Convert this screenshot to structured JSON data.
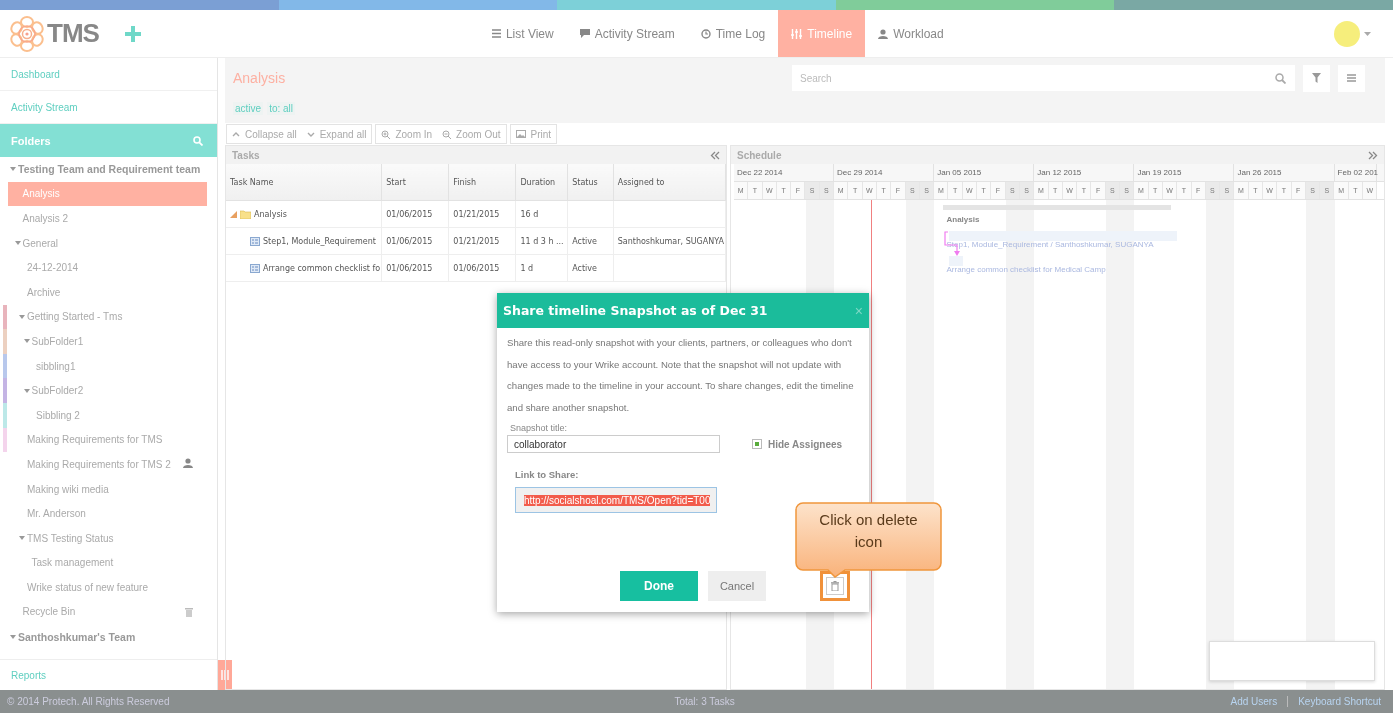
{
  "top_nav": {
    "logo": "TMS",
    "tabs": [
      {
        "label": "List View",
        "selected": false
      },
      {
        "label": "Activity Stream",
        "selected": false
      },
      {
        "label": "Time Log",
        "selected": false
      },
      {
        "label": "Timeline",
        "selected": true
      },
      {
        "label": "Workload",
        "selected": false
      }
    ]
  },
  "sidebar": {
    "links": [
      "Dashboard",
      "Activity Stream"
    ],
    "folders_title": "Folders",
    "tree": [
      {
        "label": "Testing Team and Requirement team",
        "kind": "team",
        "selected": false,
        "expanded": true,
        "children": [
          {
            "label": "Analysis",
            "kind": "folder",
            "selected": true
          },
          {
            "label": "Analysis 2",
            "kind": "folder",
            "selected": false
          },
          {
            "label": "General",
            "kind": "folder",
            "selected": false,
            "expanded": true,
            "children": [
              {
                "label": "24-12-2014",
                "kind": "folder",
                "selected": false
              },
              {
                "label": "Archive",
                "kind": "folder",
                "selected": false
              },
              {
                "label": "Getting Started - Tms",
                "kind": "folder",
                "selected": false,
                "expanded": true,
                "color": "#e8b4bc",
                "children": [
                  {
                    "label": "SubFolder1",
                    "kind": "folder",
                    "selected": false,
                    "expanded": true,
                    "color": "#ecd0c0",
                    "children": [
                      {
                        "label": "sibbling1",
                        "kind": "folder",
                        "selected": false,
                        "color": "#b8c8ec"
                      }
                    ]
                  },
                  {
                    "label": "SubFolder2",
                    "kind": "folder",
                    "selected": false,
                    "expanded": true,
                    "color": "#c4b4e4",
                    "children": [
                      {
                        "label": "Sibbling 2",
                        "kind": "folder",
                        "selected": false,
                        "color": "#bce8e8"
                      }
                    ]
                  }
                ]
              },
              {
                "label": "Making Requirements for TMS",
                "kind": "folder",
                "selected": false,
                "color": "#f4d4ec"
              },
              {
                "label": "Making Requirements for TMS 2",
                "kind": "shared",
                "selected": false
              },
              {
                "label": "Making wiki media",
                "kind": "folder",
                "selected": false
              },
              {
                "label": "Mr. Anderson",
                "kind": "folder",
                "selected": false
              },
              {
                "label": "TMS Testing Status",
                "kind": "folder",
                "selected": false,
                "expanded": true,
                "children": [
                  {
                    "label": "Task management",
                    "kind": "folder",
                    "selected": false
                  }
                ]
              },
              {
                "label": "Wrike status of new feature",
                "kind": "folder",
                "selected": false
              }
            ]
          },
          {
            "label": "Recycle Bin",
            "kind": "bin",
            "selected": false
          }
        ]
      },
      {
        "label": "Santhoshkumar's Team",
        "kind": "team",
        "selected": false,
        "expanded": true
      }
    ],
    "footer_link": "Reports"
  },
  "main": {
    "title": "Analysis",
    "search": {
      "placeholder": "Search"
    },
    "filters": [
      "active",
      "to: all"
    ],
    "toolbar": [
      {
        "label": "Collapse all"
      },
      {
        "label": "Expand all"
      },
      {
        "label": "Zoom In"
      },
      {
        "label": "Zoom Out"
      },
      {
        "label": "Print"
      }
    ],
    "tasks": {
      "title": "Tasks",
      "columns": [
        "Task Name",
        "Start",
        "Finish",
        "Duration",
        "Status",
        "Assigned to"
      ],
      "rows": [
        {
          "kind": "folder",
          "expanded": true,
          "cells": [
            "Analysis",
            "01/06/2015",
            "01/21/2015",
            "16 d",
            "",
            ""
          ]
        },
        {
          "kind": "task",
          "cells": [
            "Step1, Module_Requirement",
            "01/06/2015",
            "01/21/2015",
            "11 d 3 h ...",
            "Active",
            "Santhoshkumar, SUGANYA"
          ]
        },
        {
          "kind": "task",
          "cells": [
            "Arrange common checklist fo",
            "01/06/2015",
            "01/06/2015",
            "1 d",
            "Active",
            ""
          ]
        }
      ]
    },
    "schedule": {
      "title": "Schedule",
      "weeks": [
        {
          "label": "Dec 22 2014",
          "days": [
            "M",
            "T",
            "W",
            "T",
            "F",
            "S",
            "S"
          ]
        },
        {
          "label": "Dec 29 2014",
          "days": [
            "M",
            "T",
            "W",
            "T",
            "F",
            "S",
            "S"
          ]
        },
        {
          "label": "Jan 05 2015",
          "days": [
            "M",
            "T",
            "W",
            "T",
            "F",
            "S",
            "S"
          ]
        },
        {
          "label": "Jan 12 2015",
          "days": [
            "M",
            "T",
            "W",
            "T",
            "F",
            "S",
            "S"
          ]
        },
        {
          "label": "Jan 19 2015",
          "days": [
            "M",
            "T",
            "W",
            "T",
            "F",
            "S",
            "S"
          ]
        },
        {
          "label": "Jan 26 2015",
          "days": [
            "M",
            "T",
            "W",
            "T",
            "F",
            "S",
            "S"
          ]
        },
        {
          "label": "Feb 02 201",
          "days": [
            "M",
            "T",
            "W"
          ]
        }
      ],
      "bars": [
        {
          "kind": "summary",
          "label": "Analysis"
        },
        {
          "kind": "task",
          "label": "Step1, Module_Requirement / Santhoshkumar, SUGANYA"
        },
        {
          "kind": "task",
          "label": "Arrange common checklist for Medical Camp"
        }
      ]
    }
  },
  "dialog": {
    "title": "Share timeline Snapshot as of Dec 31",
    "close": "×",
    "text": "Share this read-only snapshot with your clients, partners, or colleagues who don't have access to your Wrike account.  Note that the snapshot will not update with changes made to the timeline in your account. To share changes, edit the timeline and share another snapshot.",
    "title_label": "Snapshot title:",
    "title_value": "collaborator",
    "hide_assignees": {
      "label": "Hide Assignees",
      "checked": true
    },
    "link_label": "Link to Share:",
    "link_value": "http://socialshoal.com/TMS/Open?tid=T00",
    "buttons": [
      "Done",
      "Cancel"
    ]
  },
  "callout": {
    "text": "Click on delete icon"
  },
  "footer": {
    "copyright": "© 2014 Protech. All Rights Reserved",
    "total": "Total: 3 Tasks",
    "links": [
      "Add Users",
      "Keyboard Shortcut"
    ]
  }
}
